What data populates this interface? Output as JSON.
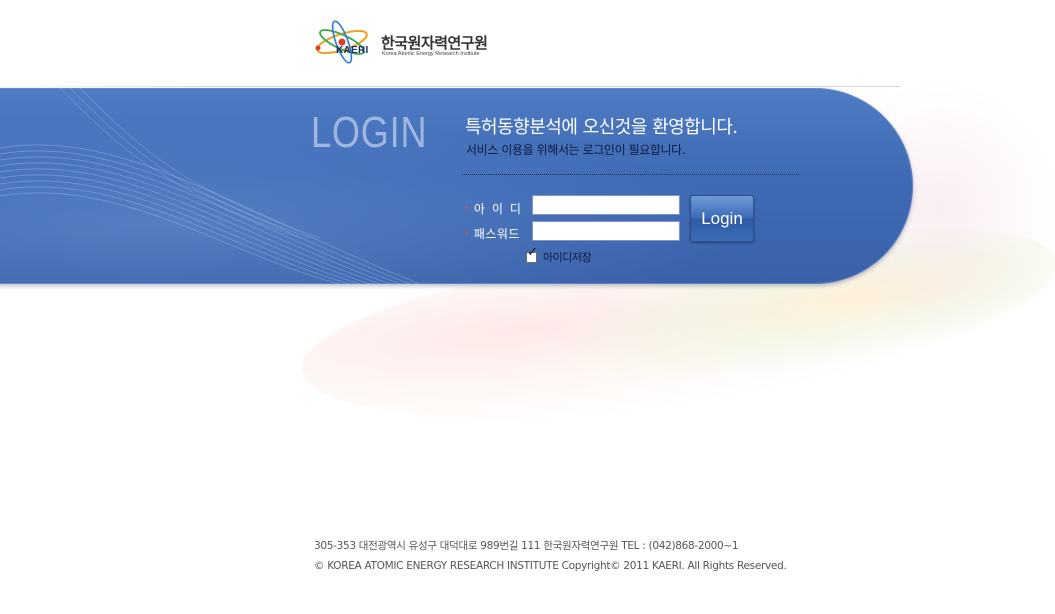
{
  "logo": {
    "abbr": "KAERI",
    "korean_name": "한국원자력연구원",
    "english_name": "Korea Atomic Energy Research Institute"
  },
  "login": {
    "title": "LOGIN",
    "welcome": "특허동향분석에 오신것을 환영합니다.",
    "sub_message": "서비스 이용을 위해서는 로그인이 필요합니다.",
    "id_label": "아이디",
    "pw_label": "패스워드",
    "id_value": "",
    "pw_value": "",
    "button_label": "Login",
    "save_id_label": "아이디저장",
    "save_id_checked": true
  },
  "footer": {
    "address": "305-353 대전광역시 유성구 대덕대로 989번길 111 한국원자력연구원 TEL : (042)868-2000~1",
    "copyright": "© KOREA ATOMIC ENERGY RESEARCH INSTITUTE  Copyright© 2011 KAERI. All Rights Reserved."
  },
  "colors": {
    "band_blue": "#3f6ab5",
    "login_title": "#9fb6df",
    "required_bullet": "#e64a4a"
  },
  "icons": {
    "logo": "atom-orbit-icon",
    "checkbox": "check-icon"
  }
}
